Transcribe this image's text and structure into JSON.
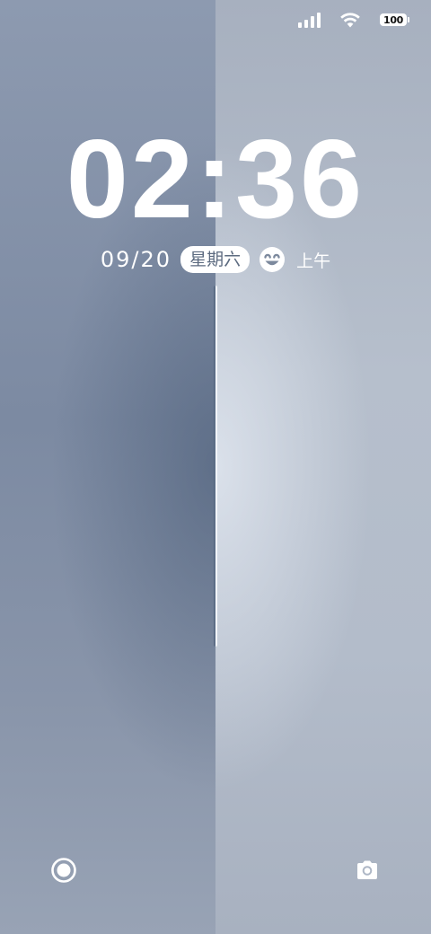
{
  "status_bar": {
    "signal_icon": "cellular-signal-icon",
    "wifi_icon": "wifi-icon",
    "battery_level": "100"
  },
  "lockscreen": {
    "time": "02:36",
    "date": "09/20",
    "weekday": "星期六",
    "weather_icon": "smiling-face-icon",
    "am_pm": "上午"
  },
  "shortcuts": {
    "left_icon": "assistant-icon",
    "right_icon": "camera-icon"
  },
  "colors": {
    "text": "#ffffff",
    "pill_text": "#5d6b80"
  }
}
